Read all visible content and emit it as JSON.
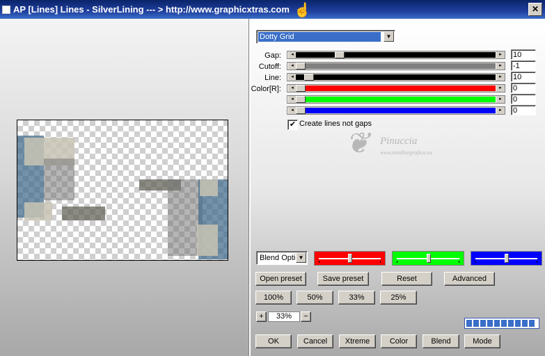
{
  "window": {
    "title": "AP [Lines]  Lines - SilverLining     --- > http://www.graphicxtras.com",
    "close_label": "✕"
  },
  "effect": {
    "selected": "Dotty Grid"
  },
  "sliders": [
    {
      "label": "Gap:",
      "value": "10",
      "color": "#000000",
      "fraction": 0.2
    },
    {
      "label": "Cutoff:",
      "value": "-1",
      "color": "#808080",
      "fraction": 0.0
    },
    {
      "label": "Line:",
      "value": "10",
      "color": "#000000",
      "fraction": 0.03
    },
    {
      "label": "Color[R]:",
      "value": "0",
      "color": "#ff0000",
      "fraction": 0.0
    },
    {
      "label": "",
      "value": "0",
      "color": "#00ff00",
      "fraction": 0.0
    },
    {
      "label": "",
      "value": "0",
      "color": "#0000ff",
      "fraction": 0.0
    }
  ],
  "create_lines": {
    "label": "Create lines not gaps",
    "checked": true
  },
  "watermark": {
    "text": "Pinuccia",
    "sub": "www.moidisegrafica.eu"
  },
  "blend": {
    "selected": "Blend Optio"
  },
  "color_sliders": [
    {
      "color": "#ff0000",
      "fraction": 0.5
    },
    {
      "color": "#00ff00",
      "fraction": 0.5
    },
    {
      "color": "#0000ff",
      "fraction": 0.5
    }
  ],
  "buttons": {
    "open_preset": "Open preset",
    "save_preset": "Save preset",
    "reset": "Reset",
    "advanced": "Advanced",
    "zoom_100": "100%",
    "zoom_50": "50%",
    "zoom_33": "33%",
    "zoom_25": "25%",
    "plus": "+",
    "minus": "−",
    "ok": "OK",
    "cancel": "Cancel",
    "xtreme": "Xtreme",
    "color": "Color",
    "blend": "Blend",
    "mode": "Mode"
  },
  "zoom": {
    "value": "33%"
  },
  "progress": {
    "cells": 10,
    "filled": 10
  }
}
